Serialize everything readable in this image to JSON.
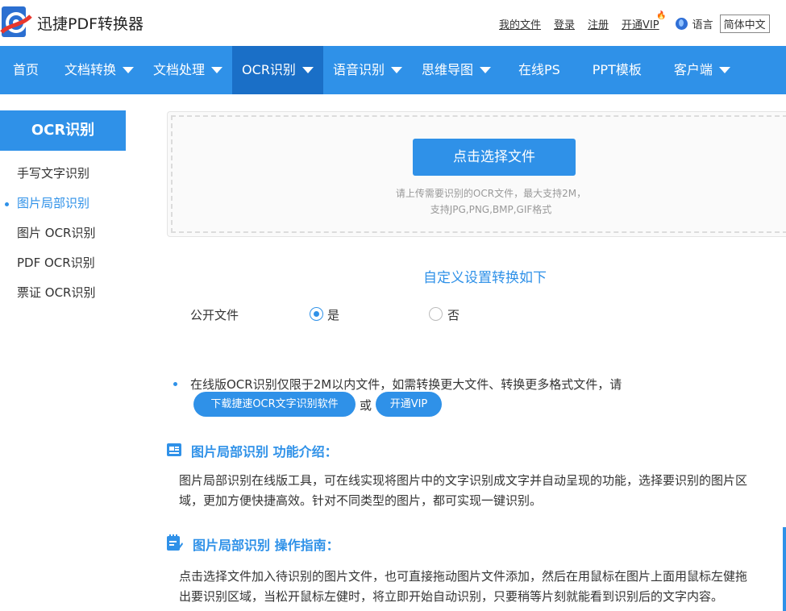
{
  "header": {
    "brand": "迅捷PDF转换器",
    "links": [
      "我的文件",
      "登录",
      "注册"
    ],
    "vip": "开通VIP",
    "lang_label": "语言",
    "lang_value": "简体中文"
  },
  "nav": [
    {
      "label": "首页",
      "dropdown": false,
      "active": false
    },
    {
      "label": "文档转换",
      "dropdown": true,
      "active": false
    },
    {
      "label": "文档处理",
      "dropdown": true,
      "active": false
    },
    {
      "label": "OCR识别",
      "dropdown": true,
      "active": true
    },
    {
      "label": "语音识别",
      "dropdown": true,
      "active": false
    },
    {
      "label": "思维导图",
      "dropdown": true,
      "active": false
    },
    {
      "label": "在线PS",
      "dropdown": false,
      "active": false
    },
    {
      "label": "PPT模板",
      "dropdown": false,
      "active": false
    },
    {
      "label": "客户端",
      "dropdown": true,
      "active": false
    }
  ],
  "sidebar": {
    "title": "OCR识别",
    "items": [
      {
        "label": "手写文字识别",
        "active": false
      },
      {
        "label": "图片局部识别",
        "active": true
      },
      {
        "label": "图片 OCR识别",
        "active": false
      },
      {
        "label": "PDF OCR识别",
        "active": false
      },
      {
        "label": "票证 OCR识别",
        "active": false
      }
    ]
  },
  "upload": {
    "button": "点击选择文件",
    "hint1": "请上传需要识别的OCR文件，最大支持2M，",
    "hint2": "支持JPG,PNG,BMP,GIF格式"
  },
  "settings": {
    "title": "自定义设置转换如下",
    "option_label": "公开文件",
    "yes": "是",
    "no": "否",
    "selected": "是"
  },
  "notice": {
    "text": "在线版OCR识别仅限于2M以内文件，如需转换更大文件、转换更多格式文件，请",
    "download_btn": "下载捷速OCR文字识别软件",
    "or": "或",
    "vip_btn": "开通VIP"
  },
  "intro": {
    "title": "图片局部识别 功能介绍：",
    "line1": "图片局部识别在线版工具，可在线实现将图片中的文字识别成文字并自动呈现的功能，选择要识别的图片区",
    "line2": "域，更加方便快捷高效。针对不同类型的图片，都可实现一键识别。"
  },
  "guide": {
    "title": "图片局部识别 操作指南：",
    "line1": "点击选择文件加入待识别的图片文件，也可直接拖动图片文件添加，然后在用鼠标在图片上面用鼠标左健拖",
    "line2": "出要识别区域，当松开鼠标左健时，将立即开始自动识别，只要稍等片刻就能看到识别后的文字内容。"
  },
  "colors": {
    "accent": "#2f91e8",
    "nav_active": "#1a6fc7"
  }
}
